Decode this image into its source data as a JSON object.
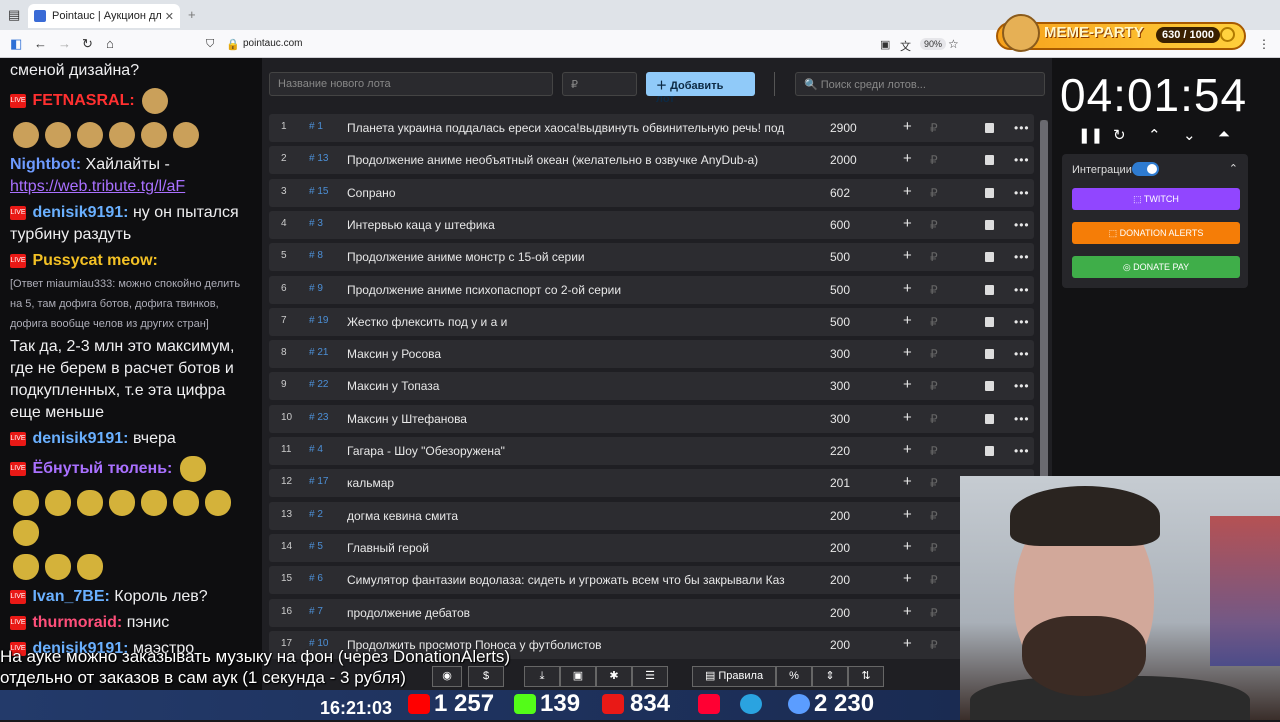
{
  "browser": {
    "tab_title": "Pointauc | Аукцион для стрима",
    "url": "pointauc.com",
    "zoom": "90%"
  },
  "overlay": {
    "brand": "MEME-PARTY",
    "counter": "630 / 1000"
  },
  "chat": {
    "lines": [
      {
        "nick": "",
        "text": "сменой дизайна?"
      },
      {
        "nick": "FETNASRAL:",
        "text": ""
      },
      {
        "nick": "Nightbot:",
        "text": "Хайлайты -",
        "link": "https://web.tribute.tg/l/aF"
      },
      {
        "nick": "denisik9191:",
        "text": "ну он пытался турбину раздуть"
      },
      {
        "nick": "Pussycat meow:",
        "text": ""
      },
      {
        "reply": "[Ответ miaumiau333: можно спокойно делить на 5, там дофига ботов, дофига твинков, дофига вообще челов из других стран]"
      },
      {
        "nick": "",
        "text": "Так да, 2-3 млн это максимум, где не берем в расчет ботов и подкупленных, т.е эта цифра еще меньше"
      },
      {
        "nick": "denisik9191:",
        "text": "вчера"
      },
      {
        "nick": "Ёбнутый тюлень:",
        "text": ""
      },
      {
        "nick": "Ivan_7BE:",
        "text": "Король лев?"
      },
      {
        "nick": "thurmoraid:",
        "text": "пэнис"
      },
      {
        "nick": "denisik9191:",
        "text": "маэстро"
      }
    ]
  },
  "lots_form": {
    "name_placeholder": "Название нового лота",
    "amount_placeholder": "₽",
    "add_label": "Добавить лот",
    "search_placeholder": "Поиск среди лотов..."
  },
  "lots": [
    {
      "idx": "1",
      "id": "# 1",
      "name": "Планета украина поддалась ереси хаоса!выдвинуть обвинительную речь! под",
      "amount": "2900"
    },
    {
      "idx": "2",
      "id": "# 13",
      "name": "Продолжение аниме необъятный океан (желательно в озвучке AnyDub-а)",
      "amount": "2000"
    },
    {
      "idx": "3",
      "id": "# 15",
      "name": "Сопрано",
      "amount": "602"
    },
    {
      "idx": "4",
      "id": "# 3",
      "name": "Интервью каца у штефика",
      "amount": "600"
    },
    {
      "idx": "5",
      "id": "# 8",
      "name": "Продолжение аниме монстр с 15-ой серии",
      "amount": "500"
    },
    {
      "idx": "6",
      "id": "# 9",
      "name": "Продолжение аниме психопаспорт со 2-ой серии",
      "amount": "500"
    },
    {
      "idx": "7",
      "id": "# 19",
      "name": "Жестко флексить под у и а и",
      "amount": "500"
    },
    {
      "idx": "8",
      "id": "# 21",
      "name": "Максин у Росова",
      "amount": "300"
    },
    {
      "idx": "9",
      "id": "# 22",
      "name": "Максин у Топаза",
      "amount": "300"
    },
    {
      "idx": "10",
      "id": "# 23",
      "name": "Максин у Штефанова",
      "amount": "300"
    },
    {
      "idx": "11",
      "id": "# 4",
      "name": "Гагара - Шоу \"Обезоружена\"",
      "amount": "220"
    },
    {
      "idx": "12",
      "id": "# 17",
      "name": "кальмар",
      "amount": "201"
    },
    {
      "idx": "13",
      "id": "# 2",
      "name": "догма кевина смита",
      "amount": "200"
    },
    {
      "idx": "14",
      "id": "# 5",
      "name": "Главный герой",
      "amount": "200"
    },
    {
      "idx": "15",
      "id": "# 6",
      "name": "Симулятор фантазии водолаза: сидеть и угрожать всем что бы закрывали Каз",
      "amount": "200"
    },
    {
      "idx": "16",
      "id": "# 7",
      "name": "продолжение дебатов",
      "amount": "200"
    },
    {
      "idx": "17",
      "id": "# 10",
      "name": "Продолжить просмотр Поноса у футболистов",
      "amount": "200"
    }
  ],
  "row_rub": "₽",
  "timer": {
    "value": "04:01:54",
    "integrations_label": "Интеграции",
    "twitch_label": "TWITCH",
    "donation_alerts_label": "DONATION ALERTS",
    "donate_pay_label": "DONATE PAY",
    "twitch_color": "#9146ff",
    "da_color": "#f57d07",
    "dp_color": "#3fae49"
  },
  "bottom": {
    "rules_label": "Правила",
    "percent_label": "%",
    "dollar_label": "$"
  },
  "caption": {
    "line1": "На ауке можно заказывать музыку на фон (через DonationAlerts)",
    "line2": "отдельно от заказов в сам аук (1 секунда - 3 рубля)"
  },
  "stats": {
    "time": "16:21:03",
    "youtube": "1 257",
    "kick": "139",
    "vk": "834",
    "telegram": "",
    "viewers": "2 230"
  }
}
